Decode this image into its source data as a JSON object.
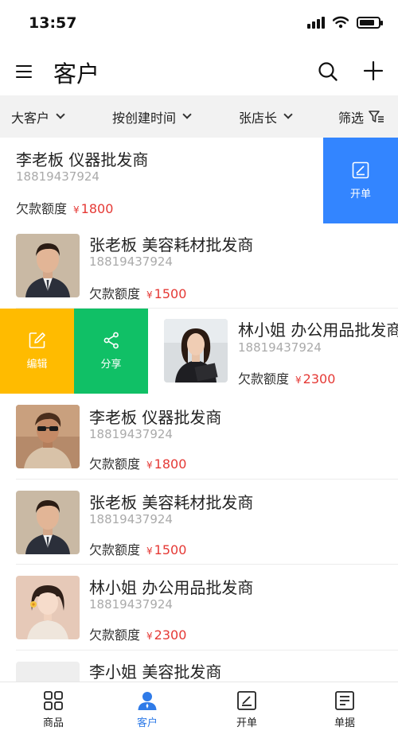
{
  "status_bar": {
    "time": "13:57",
    "icons": [
      "signal-icon",
      "wifi-icon",
      "battery-icon"
    ]
  },
  "header": {
    "title": "客户",
    "icons": [
      "menu-icon",
      "search-icon",
      "add-icon"
    ]
  },
  "filters": [
    {
      "label": "大客户"
    },
    {
      "label": "按创建时间"
    },
    {
      "label": "张店长"
    },
    {
      "label": "筛选"
    }
  ],
  "debt_label": "欠款额度",
  "currency": "¥",
  "customers": [
    {
      "name": "李老板 仪器批发商",
      "phone": "18819437924",
      "debt": "1800",
      "avatar": "none",
      "swipe": "left",
      "actions": [
        "开单"
      ]
    },
    {
      "name": "张老板 美容耗材批发商",
      "phone": "18819437924",
      "debt": "1500",
      "avatar": "man-suit"
    },
    {
      "name": "林小姐 办公用品批发商",
      "phone": "18819437924",
      "debt": "2300",
      "avatar": "woman-business",
      "swipe": "right",
      "actions": [
        "编辑",
        "分享"
      ]
    },
    {
      "name": "李老板 仪器批发商",
      "phone": "18819437924",
      "debt": "1800",
      "avatar": "man-sunglasses"
    },
    {
      "name": "张老板 美容耗材批发商",
      "phone": "18819437924",
      "debt": "1500",
      "avatar": "man-suit"
    },
    {
      "name": "林小姐 办公用品批发商",
      "phone": "18819437924",
      "debt": "2300",
      "avatar": "woman-flower"
    },
    {
      "name": "李小姐 美容批发商",
      "phone": "",
      "debt": "",
      "avatar": "placeholder"
    }
  ],
  "tabs": [
    {
      "label": "商品",
      "icon": "grid-icon"
    },
    {
      "label": "客户",
      "icon": "person-icon",
      "active": true
    },
    {
      "label": "开单",
      "icon": "edit-box-icon"
    },
    {
      "label": "单据",
      "icon": "document-icon"
    }
  ],
  "colors": {
    "accent": "#2f7be8",
    "create_order": "#3385ff",
    "edit": "#ffbb00",
    "share": "#10c066",
    "debt_amount": "#e53935",
    "filter_bg": "#f2f2f2"
  }
}
